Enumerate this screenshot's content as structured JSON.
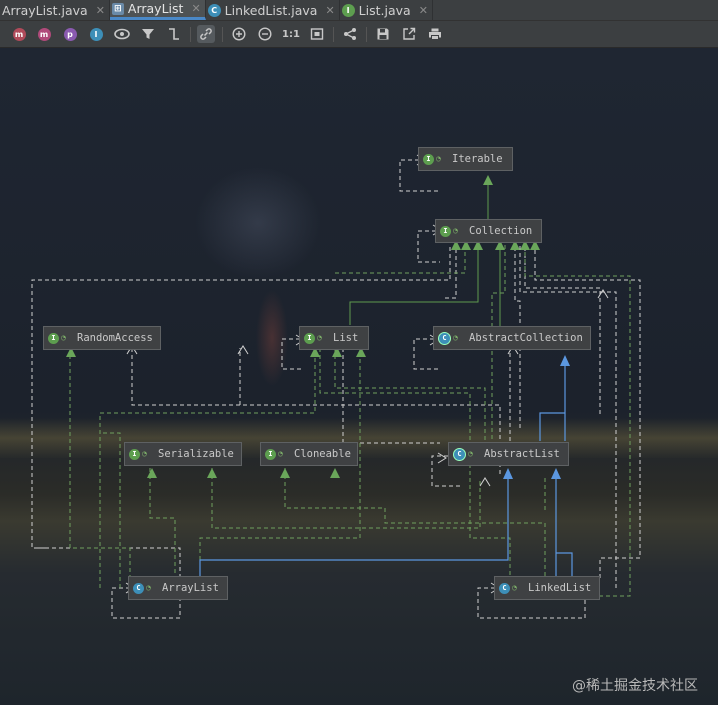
{
  "tabs": [
    {
      "label": "ArrayList.java",
      "icon": "class-icon",
      "active": false
    },
    {
      "label": "ArrayList",
      "icon": "diagram-icon",
      "active": true
    },
    {
      "label": "LinkedList.java",
      "icon": "class-icon",
      "active": false
    },
    {
      "label": "List.java",
      "icon": "interface-icon",
      "active": false
    }
  ],
  "toolbar": {
    "actual_size_label": "1:1"
  },
  "diagram": {
    "nodes": {
      "iterable": {
        "label": "Iterable",
        "kind": "interface"
      },
      "collection": {
        "label": "Collection",
        "kind": "interface"
      },
      "random_access": {
        "label": "RandomAccess",
        "kind": "interface"
      },
      "list": {
        "label": "List",
        "kind": "interface"
      },
      "abstract_collection": {
        "label": "AbstractCollection",
        "kind": "abstract-class"
      },
      "serializable": {
        "label": "Serializable",
        "kind": "interface"
      },
      "cloneable": {
        "label": "Cloneable",
        "kind": "interface"
      },
      "abstract_list": {
        "label": "AbstractList",
        "kind": "abstract-class"
      },
      "array_list": {
        "label": "ArrayList",
        "kind": "class"
      },
      "linked_list": {
        "label": "LinkedList",
        "kind": "class"
      }
    }
  },
  "watermark": "@稀土掘金技术社区",
  "colors": {
    "interface_icon": "#5d9e4f",
    "class_icon": "#3d8fb8",
    "extends_line": "#5e9a4e",
    "class_extends_line": "#5b97e0",
    "dashed_line": "#cfcfcf"
  }
}
